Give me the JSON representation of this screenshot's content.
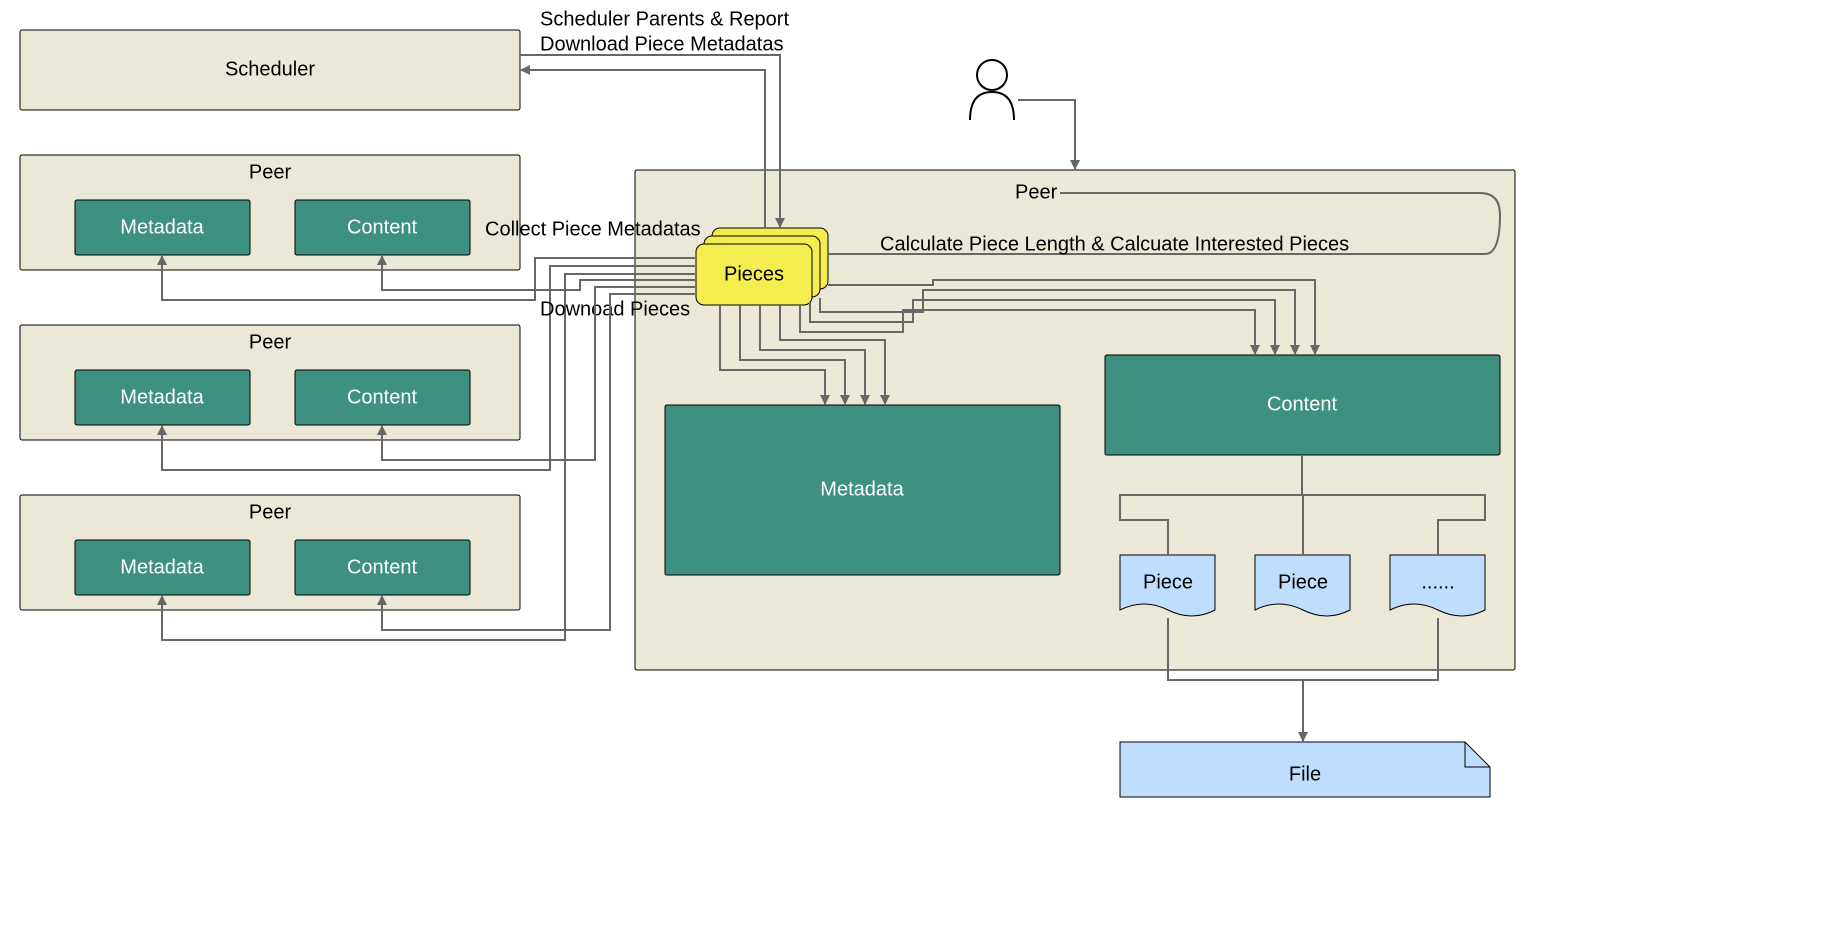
{
  "scheduler": {
    "title": "Scheduler"
  },
  "peers_left": [
    {
      "title": "Peer",
      "metadata": "Metadata",
      "content": "Content"
    },
    {
      "title": "Peer",
      "metadata": "Metadata",
      "content": "Content"
    },
    {
      "title": "Peer",
      "metadata": "Metadata",
      "content": "Content"
    }
  ],
  "main_peer": {
    "title": "Peer",
    "pieces": "Pieces",
    "metadata": "Metadata",
    "content": "Content",
    "piece_items": [
      "Piece",
      "Piece",
      "......"
    ],
    "file": "File"
  },
  "labels": {
    "scheduler_report": "Scheduler Parents & Report",
    "download_piece_meta": "Download Piece Metadatas",
    "collect_piece_meta": "Collect Piece Metadatas",
    "download_pieces": "Downoad Pieces",
    "calculate": "Calculate Piece Length &  Calcuate Interested Pieces"
  }
}
